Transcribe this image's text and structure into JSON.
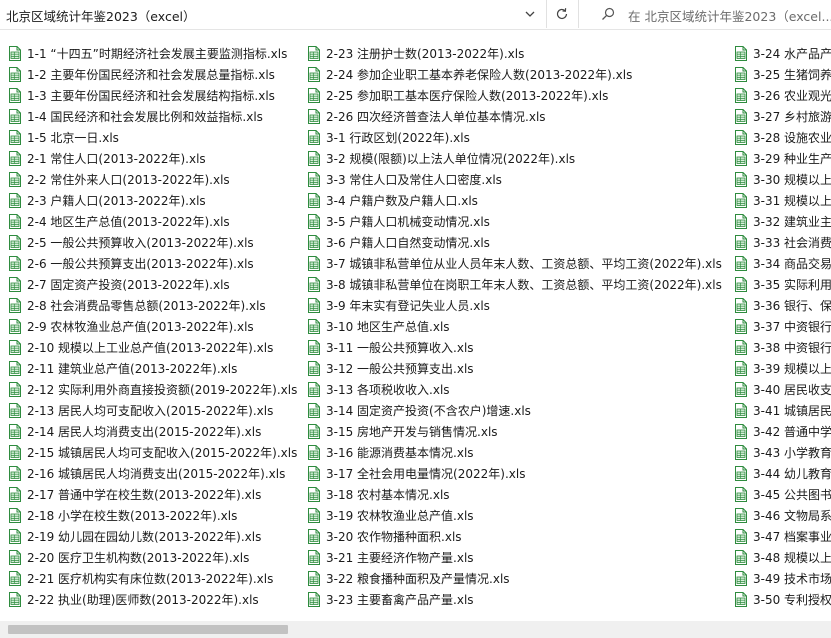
{
  "address": {
    "path": "北京区域统计年鉴2023（excel）",
    "search_placeholder": "在 北京区域统计年鉴2023（excel..."
  },
  "icons": {
    "dropdown": "chevron-down-icon",
    "refresh": "refresh-icon",
    "search": "search-icon",
    "file": "excel-file-icon"
  },
  "colors": {
    "excel_green": "#2e8b3e",
    "scroll_thumb": "#c2c2c2"
  },
  "files": {
    "col1": [
      "1-1 “十四五”时期经济社会发展主要监测指标.xls",
      "1-2 主要年份国民经济和社会发展总量指标.xls",
      "1-3 主要年份国民经济和社会发展结构指标.xls",
      "1-4 国民经济和社会发展比例和效益指标.xls",
      "1-5 北京一日.xls",
      "2-1 常住人口(2013-2022年).xls",
      "2-2 常住外来人口(2013-2022年).xls",
      "2-3 户籍人口(2013-2022年).xls",
      "2-4 地区生产总值(2013-2022年).xls",
      "2-5 一般公共预算收入(2013-2022年).xls",
      "2-6 一般公共预算支出(2013-2022年).xls",
      "2-7 固定资产投资(2013-2022年).xls",
      "2-8 社会消费品零售总额(2013-2022年).xls",
      "2-9 农林牧渔业总产值(2013-2022年).xls",
      "2-10 规模以上工业总产值(2013-2022年).xls",
      "2-11 建筑业总产值(2013-2022年).xls",
      "2-12 实际利用外商直接投资额(2019-2022年).xls",
      "2-13 居民人均可支配收入(2015-2022年).xls",
      "2-14 居民人均消费支出(2015-2022年).xls",
      "2-15 城镇居民人均可支配收入(2015-2022年).xls",
      "2-16 城镇居民人均消费支出(2015-2022年).xls",
      "2-17 普通中学在校生数(2013-2022年).xls",
      "2-18 小学在校生数(2013-2022年).xls",
      "2-19 幼儿园在园幼儿数(2013-2022年).xls",
      "2-20 医疗卫生机构数(2013-2022年).xls",
      "2-21 医疗机构实有床位数(2013-2022年).xls",
      "2-22 执业(助理)医师数(2013-2022年).xls"
    ],
    "col2": [
      "2-23 注册护士数(2013-2022年).xls",
      "2-24 参加企业职工基本养老保险人数(2013-2022年).xls",
      "2-25 参加职工基本医疗保险人数(2013-2022年).xls",
      "2-26 四次经济普查法人单位基本情况.xls",
      "3-1 行政区划(2022年).xls",
      "3-2 规模(限额)以上法人单位情况(2022年).xls",
      "3-3 常住人口及常住人口密度.xls",
      "3-4 户籍户数及户籍人口.xls",
      "3-5 户籍人口机械变动情况.xls",
      "3-6 户籍人口自然变动情况.xls",
      "3-7 城镇非私营单位从业人员年末人数、工资总额、平均工资(2022年).xls",
      "3-8 城镇非私营单位在岗职工年末人数、工资总额、平均工资(2022年).xls",
      "3-9 年末实有登记失业人员.xls",
      "3-10 地区生产总值.xls",
      "3-11 一般公共预算收入.xls",
      "3-12 一般公共预算支出.xls",
      "3-13 各项税收收入.xls",
      "3-14 固定资产投资(不含农户)增速.xls",
      "3-15 房地产开发与销售情况.xls",
      "3-16 能源消费基本情况.xls",
      "3-17 全社会用电量情况(2022年).xls",
      "3-18 农村基本情况.xls",
      "3-19 农林牧渔业总产值.xls",
      "3-20 农作物播种面积.xls",
      "3-21 主要经济作物产量.xls",
      "3-22 粮食播种面积及产量情况.xls",
      "3-23 主要畜禽产品产量.xls"
    ],
    "col3": [
      "3-24 水产品产",
      "3-25 生猪饲养",
      "3-26 农业观光",
      "3-27 乡村旅游",
      "3-28 设施农业",
      "3-29 种业生产",
      "3-30 规模以上",
      "3-31 规模以上",
      "3-32 建筑业主",
      "3-33 社会消费",
      "3-34 商品交易",
      "3-35 实际利用",
      "3-36 银行、保",
      "3-37 中资银行",
      "3-38 中资银行",
      "3-39 规模以上",
      "3-40 居民收支",
      "3-41 城镇居民",
      "3-42 普通中学",
      "3-43 小学教育",
      "3-44 幼儿教育",
      "3-45 公共图书",
      "3-46 文物局系",
      "3-47 档案事业",
      "3-48 规模以上",
      "3-49 技术市场",
      "3-50 专利授权"
    ]
  }
}
